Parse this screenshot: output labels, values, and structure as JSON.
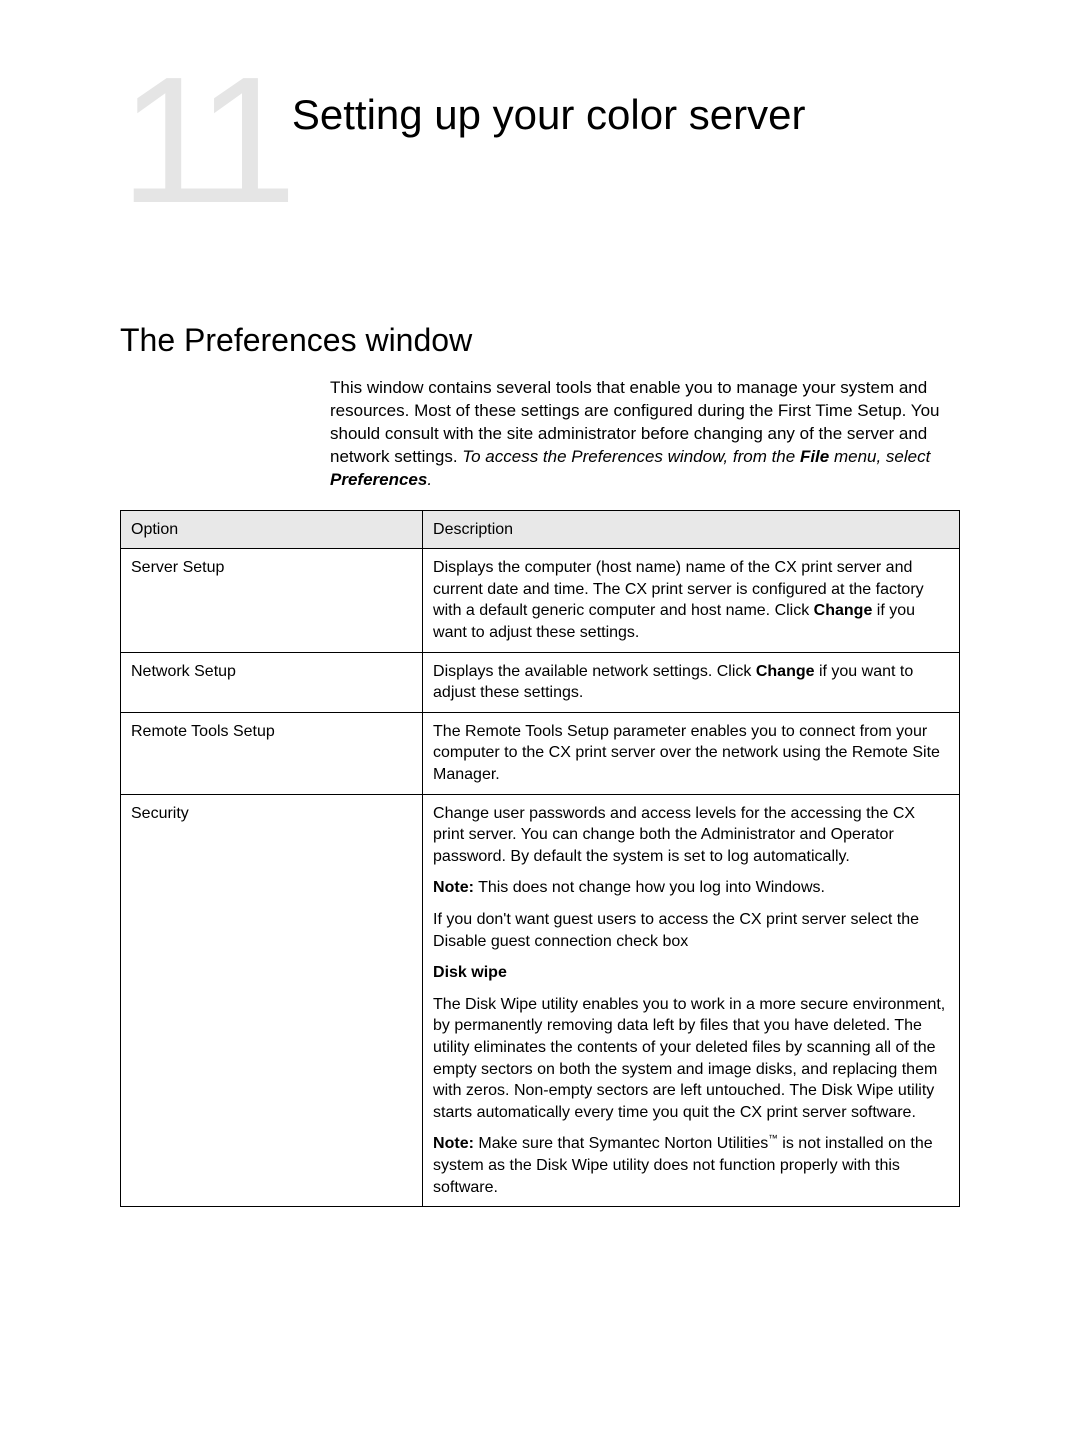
{
  "chapter": {
    "number": "11",
    "title": "Setting up your color server"
  },
  "section": {
    "heading": "The Preferences window",
    "intro_part1": "This window contains several tools that enable you to manage your system and resources. Most of these settings are configured during the First Time Setup. You should consult with the site administrator before changing any of the server and network settings. ",
    "intro_italic1": "To access the Preferences window, from the ",
    "intro_bold_italic": "File",
    "intro_italic2": " menu, select ",
    "intro_bold_italic2": "Preferences",
    "intro_italic3": "."
  },
  "table": {
    "headers": {
      "option": "Option",
      "description": "Description"
    },
    "rows": [
      {
        "option": "Server Setup",
        "desc_pre": "Displays the computer (host name) name of the CX print server and current date and time. The CX print server is configured at the factory with a default generic computer and host name. Click ",
        "desc_bold": "Change",
        "desc_post": " if you want to adjust these settings."
      },
      {
        "option": "Network Setup",
        "desc_pre": "Displays the available network settings. Click ",
        "desc_bold": "Change",
        "desc_post": " if you want to adjust these settings."
      },
      {
        "option": "Remote Tools Setup",
        "desc_plain": "The Remote Tools Setup parameter enables you to connect from your computer to the CX print server over the network using the Remote Site Manager."
      },
      {
        "option": "Security",
        "p1": "Change user passwords and access levels for the accessing the CX print server. You can change both the Administrator and Operator password. By default the system is set to log automatically.",
        "p2_bold": "Note:",
        "p2_rest": " This does not change how you log into Windows.",
        "p3": "If you don't want guest users to access the CX print server select the Disable guest connection check box",
        "p4_bold": "Disk wipe",
        "p5": "The Disk Wipe utility enables you to work in a more secure environment, by permanently removing data left by files that you have deleted. The utility eliminates the contents of your deleted files by scanning all of the empty sectors on both the system and image disks, and replacing them with zeros. Non-empty sectors are left untouched. The Disk Wipe utility starts automatically every time you quit the CX print server software.",
        "p6_bold": "Note:",
        "p6_rest_pre": " Make sure that Symantec Norton Utilities",
        "p6_tm": "™",
        "p6_rest_post": " is not installed on the system as the Disk Wipe utility does not function properly with this software."
      }
    ]
  }
}
